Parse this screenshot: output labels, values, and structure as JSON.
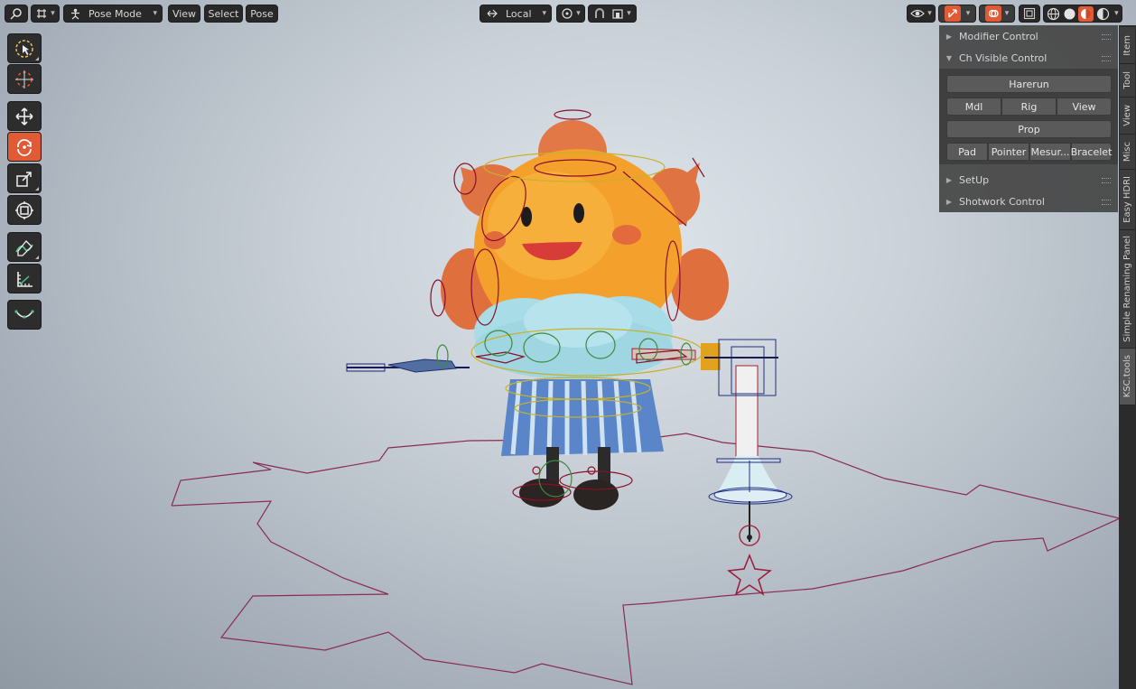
{
  "header": {
    "mode": "Pose Mode",
    "menus": [
      "View",
      "Select",
      "Pose"
    ],
    "transform_orientation": "Local"
  },
  "toolbar": {
    "tools": [
      "cursor-tool",
      "transform-cursor-tool",
      "move-tool",
      "rotate-tool",
      "scale-tool",
      "transform-tool",
      "annotate-tool",
      "measure-tool",
      "relax-tool"
    ],
    "active": "rotate-tool"
  },
  "npanel": {
    "panels": {
      "modifier_control": "Modifier Control",
      "ch_visible_control": "Ch Visible Control",
      "setup": "SetUp",
      "shotwork_control": "Shotwork Control"
    },
    "buttons": {
      "harerun": "Harerun",
      "mdl": "Mdl",
      "rig": "Rig",
      "view": "View",
      "prop": "Prop",
      "pad": "Pad",
      "pointer": "Pointer",
      "mesur": "Mesur...",
      "bracelet": "Bracelet"
    }
  },
  "tabs": [
    "Item",
    "Tool",
    "View",
    "Misc",
    "Easy HDRI",
    "Simple Renaming Panel",
    "KSC.tools"
  ],
  "active_tab": "KSC.tools",
  "colors": {
    "accent_orange": "#e05a35",
    "panel_bg": "#464646",
    "header_bg": "#282828"
  }
}
